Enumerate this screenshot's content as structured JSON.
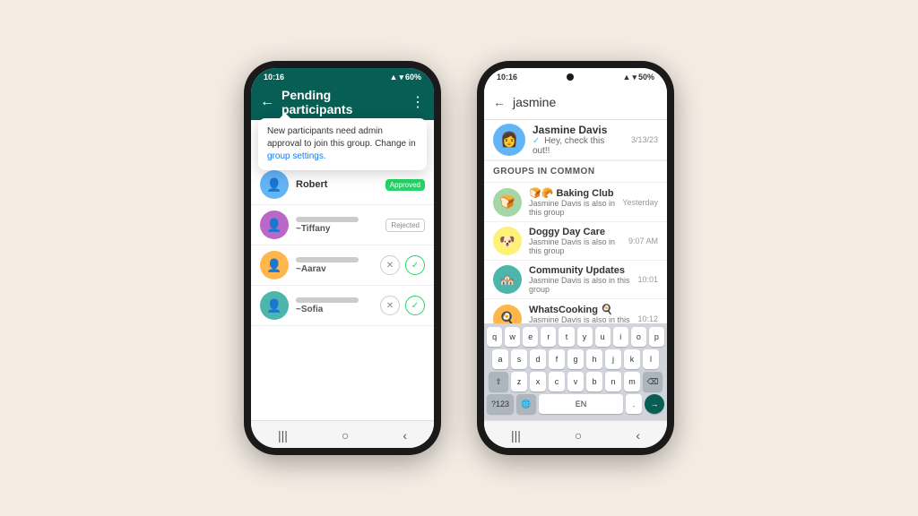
{
  "phone1": {
    "status_time": "10:16",
    "status_battery": "60%",
    "app_title": "Pending participants",
    "tooltip": {
      "text": "New participants need admin approval to join this group. Change in ",
      "link": "group settings."
    },
    "participants": [
      {
        "name": "Robert",
        "sub": "",
        "blurred": false,
        "badge": "Approved",
        "actions": "none"
      },
      {
        "name": "~Tiffany",
        "sub": "",
        "blurred": true,
        "badge": "Rejected",
        "actions": "none"
      },
      {
        "name": "~Aarav",
        "sub": "",
        "blurred": true,
        "badge": "",
        "actions": "xcheck"
      },
      {
        "name": "~Sofia",
        "sub": "",
        "blurred": true,
        "badge": "",
        "actions": "xcheck"
      }
    ],
    "nav": [
      "|||",
      "○",
      "‹"
    ]
  },
  "phone2": {
    "status_time": "10:16",
    "status_battery": "50%",
    "search_text": "jasmine",
    "contact": {
      "name": "Jasmine Davis",
      "time": "3/13/23",
      "last_msg": "✓ Hey, check this out!!"
    },
    "groups_banner": "GROUPS IN COMMON",
    "groups": [
      {
        "name": "🍞🥐 Baking Club",
        "sub": "Jasmine Davis is also in this group",
        "time": "Yesterday",
        "emoji": "🍞🥐"
      },
      {
        "name": "Doggy Day Care",
        "sub": "Jasmine Davis is also in this group",
        "time": "9:07 AM",
        "emoji": "🐶"
      },
      {
        "name": "Community Updates",
        "sub": "Jasmine Davis is also in this group",
        "time": "10:01",
        "emoji": "🏘️"
      },
      {
        "name": "WhatsCooking 🍳",
        "sub": "Jasmine Davis is also in this group",
        "time": "10:12",
        "emoji": "🍳"
      }
    ],
    "keyboard_row1": [
      "q",
      "w",
      "e",
      "r",
      "t",
      "y",
      "u",
      "i",
      "o",
      "p"
    ],
    "keyboard_row2": [
      "a",
      "s",
      "d",
      "f",
      "g",
      "h",
      "j",
      "k",
      "l"
    ],
    "keyboard_row3": [
      "z",
      "x",
      "c",
      "v",
      "b",
      "n",
      "m"
    ],
    "keyboard_bottom": [
      "?123",
      "🌐",
      "EN",
      ".",
      "→"
    ],
    "nav": [
      "|||",
      "○",
      "‹"
    ]
  }
}
